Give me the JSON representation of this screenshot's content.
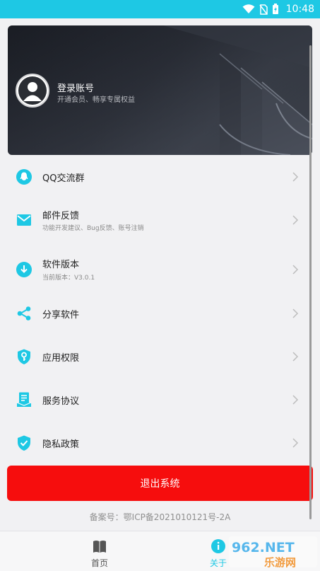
{
  "status_bar": {
    "time": "10:48",
    "bg_color": "#1ec8e4"
  },
  "profile": {
    "title": "登录账号",
    "subtitle": "开通会员、畅享专属权益",
    "avatar_icon": "user-avatar-icon"
  },
  "menu": {
    "items": [
      {
        "label": "QQ交流群",
        "sub": "",
        "icon": "qq-icon"
      },
      {
        "label": "邮件反馈",
        "sub": "功能开发建议、Bug反馈、账号注销",
        "icon": "mail-icon"
      },
      {
        "label": "软件版本",
        "sub": "当前版本：V3.0.1",
        "icon": "download-icon"
      },
      {
        "label": "分享软件",
        "sub": "",
        "icon": "share-icon"
      },
      {
        "label": "应用权限",
        "sub": "",
        "icon": "key-shield-icon"
      },
      {
        "label": "服务协议",
        "sub": "",
        "icon": "document-icon"
      },
      {
        "label": "隐私政策",
        "sub": "",
        "icon": "shield-check-icon"
      }
    ],
    "accent_color": "#1ec8e4"
  },
  "logout": {
    "label": "退出系统",
    "color": "#f60d0d"
  },
  "icp": {
    "text": "备案号：鄂ICP备2021010121号-2A"
  },
  "bottom_nav": {
    "items": [
      {
        "label": "首页",
        "icon": "book-icon"
      },
      {
        "label": "关于",
        "icon": "info-icon"
      }
    ]
  },
  "watermark": {
    "line1": "962.NET",
    "line2": "乐游网"
  }
}
